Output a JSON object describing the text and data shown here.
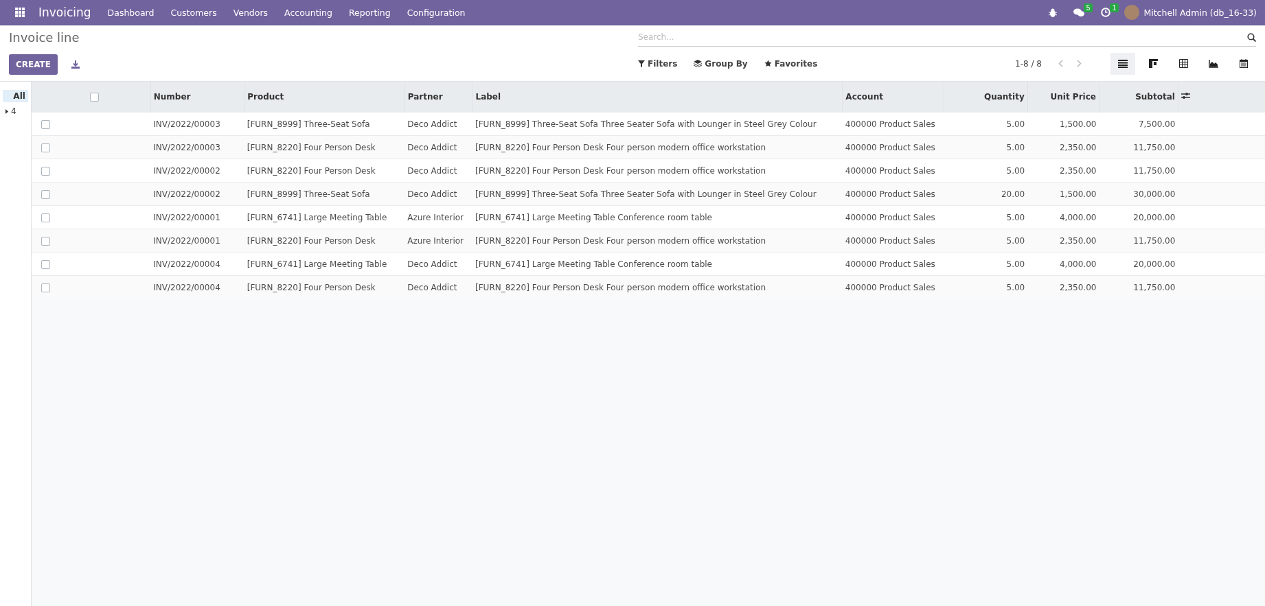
{
  "navbar": {
    "app": "Invoicing",
    "menus": [
      "Dashboard",
      "Customers",
      "Vendors",
      "Accounting",
      "Reporting",
      "Configuration"
    ],
    "message_count": "5",
    "activity_count": "1",
    "user": "Mitchell Admin (db_16-33)"
  },
  "control_panel": {
    "title": "Invoice line",
    "create": "CREATE",
    "search": {
      "placeholder": "Search..."
    },
    "filters": "Filters",
    "group_by": "Group By",
    "favorites": "Favorites",
    "pager": "1-8 / 8",
    "views": [
      {
        "kind": "list",
        "selected": true
      },
      {
        "kind": "kanban",
        "selected": false
      },
      {
        "kind": "pivot",
        "selected": false
      },
      {
        "kind": "graph",
        "selected": false
      },
      {
        "kind": "calendar",
        "selected": false
      }
    ]
  },
  "side_panel": {
    "items": [
      {
        "label": "All",
        "selected": true
      },
      {
        "label": "4",
        "selected": false
      }
    ]
  },
  "table": {
    "all_checked": false,
    "columns": [
      {
        "label": "Number",
        "kind": "text"
      },
      {
        "label": "Product",
        "kind": "text"
      },
      {
        "label": "Partner",
        "kind": "text"
      },
      {
        "label": "Label",
        "kind": "text"
      },
      {
        "label": "Account",
        "kind": "text"
      },
      {
        "label": "Quantity",
        "kind": "number"
      },
      {
        "label": "Unit Price",
        "kind": "number"
      },
      {
        "label": "Subtotal",
        "kind": "number"
      }
    ],
    "rows": [
      {
        "checked": false,
        "cells": [
          "INV/2022/00003",
          "[FURN_8999] Three-Seat Sofa",
          "Deco Addict",
          "[FURN_8999] Three-Seat Sofa Three Seater Sofa with Lounger in Steel Grey Colour",
          "400000 Product Sales",
          "5.00",
          "1,500.00",
          "7,500.00"
        ]
      },
      {
        "checked": false,
        "cells": [
          "INV/2022/00003",
          "[FURN_8220] Four Person Desk",
          "Deco Addict",
          "[FURN_8220] Four Person Desk Four person modern office workstation",
          "400000 Product Sales",
          "5.00",
          "2,350.00",
          "11,750.00"
        ]
      },
      {
        "checked": false,
        "cells": [
          "INV/2022/00002",
          "[FURN_8220] Four Person Desk",
          "Deco Addict",
          "[FURN_8220] Four Person Desk Four person modern office workstation",
          "400000 Product Sales",
          "5.00",
          "2,350.00",
          "11,750.00"
        ]
      },
      {
        "checked": false,
        "cells": [
          "INV/2022/00002",
          "[FURN_8999] Three-Seat Sofa",
          "Deco Addict",
          "[FURN_8999] Three-Seat Sofa Three Seater Sofa with Lounger in Steel Grey Colour",
          "400000 Product Sales",
          "20.00",
          "1,500.00",
          "30,000.00"
        ]
      },
      {
        "checked": false,
        "cells": [
          "INV/2022/00001",
          "[FURN_6741] Large Meeting Table",
          "Azure Interior",
          "[FURN_6741] Large Meeting Table Conference room table",
          "400000 Product Sales",
          "5.00",
          "4,000.00",
          "20,000.00"
        ]
      },
      {
        "checked": false,
        "cells": [
          "INV/2022/00001",
          "[FURN_8220] Four Person Desk",
          "Azure Interior",
          "[FURN_8220] Four Person Desk Four person modern office workstation",
          "400000 Product Sales",
          "5.00",
          "2,350.00",
          "11,750.00"
        ]
      },
      {
        "checked": false,
        "cells": [
          "INV/2022/00004",
          "[FURN_6741] Large Meeting Table",
          "Deco Addict",
          "[FURN_6741] Large Meeting Table Conference room table",
          "400000 Product Sales",
          "5.00",
          "4,000.00",
          "20,000.00"
        ]
      },
      {
        "checked": false,
        "cells": [
          "INV/2022/00004",
          "[FURN_8220] Four Person Desk",
          "Deco Addict",
          "[FURN_8220] Four Person Desk Four person modern office workstation",
          "400000 Product Sales",
          "5.00",
          "2,350.00",
          "11,750.00"
        ]
      }
    ]
  }
}
